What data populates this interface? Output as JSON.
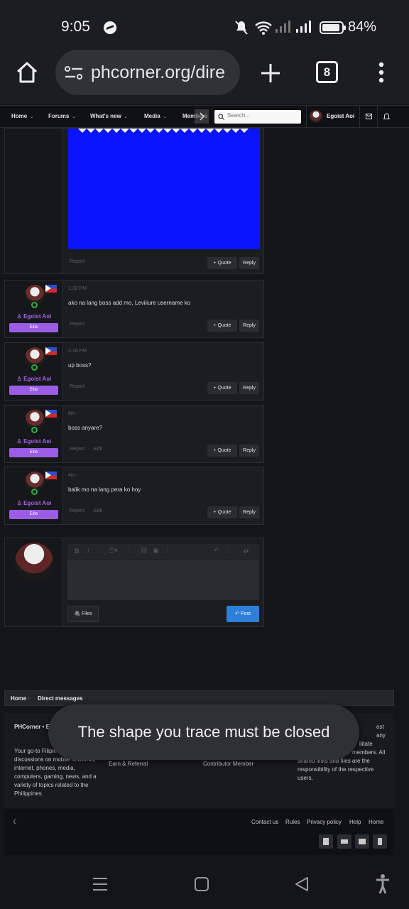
{
  "status": {
    "time": "9:05",
    "battery": "84%"
  },
  "browser": {
    "url": "phcorner.org/dire",
    "tab_count": "8"
  },
  "site_nav": {
    "items": [
      "Home",
      "Forums",
      "What's new",
      "Media",
      "Members"
    ],
    "search_placeholder": "Search...",
    "user": "Egoist Aoi"
  },
  "first_post": {
    "report": "Report",
    "quote": "Quote",
    "reply": "Reply"
  },
  "posts": [
    {
      "user": "Egoist Aoi",
      "badge": "Elite",
      "time": "1:32 PM",
      "message": "ako na lang boss add mo, Leviiiure username ko",
      "report": "Report",
      "edit": "",
      "quote": "Quote",
      "reply": "Reply"
    },
    {
      "user": "Egoist Aoi",
      "badge": "Elite",
      "time": "2:16 PM",
      "message": "up boss?",
      "report": "Report",
      "edit": "",
      "quote": "Quote",
      "reply": "Reply"
    },
    {
      "user": "Egoist Aoi",
      "badge": "Elite",
      "time": "6m",
      "message": "boss anyare?",
      "report": "Report",
      "edit": "Edit",
      "quote": "Quote",
      "reply": "Reply"
    },
    {
      "user": "Egoist Aoi",
      "badge": "Elite",
      "time": "4m",
      "message": "balik mo na lang pera ko hoy",
      "report": "Report",
      "edit": "Edit",
      "quote": "Quote",
      "reply": "Reply"
    }
  ],
  "composer": {
    "files_label": "Files",
    "post_label": "Post"
  },
  "breadcrumb": {
    "home": "Home",
    "current": "Direct messages"
  },
  "footer": {
    "brand": "PHCorner • Est. 2011",
    "description": "Your go-to Filipino forum for discussions on mobile networks, internet, phones, media, computers, gaming, news, and a variety of topics related to the Philippines.",
    "col2": "Earn & Referral",
    "col3": "Contributor Member",
    "disclaimer_top": "ost any",
    "disclaimer_mid": "ilitate",
    "disclaimer_mid2": "members. All",
    "disclaimer": "shared links and files are the responsibility of the respective users.",
    "links": [
      "Contact us",
      "Rules",
      "Privacy policy",
      "Help",
      "Home"
    ]
  },
  "toast": "The shape you trace must be closed",
  "colors": {
    "accent": "#9b5de5",
    "post_button": "#2d7fd8",
    "attachment_blue": "#0a14ff"
  }
}
